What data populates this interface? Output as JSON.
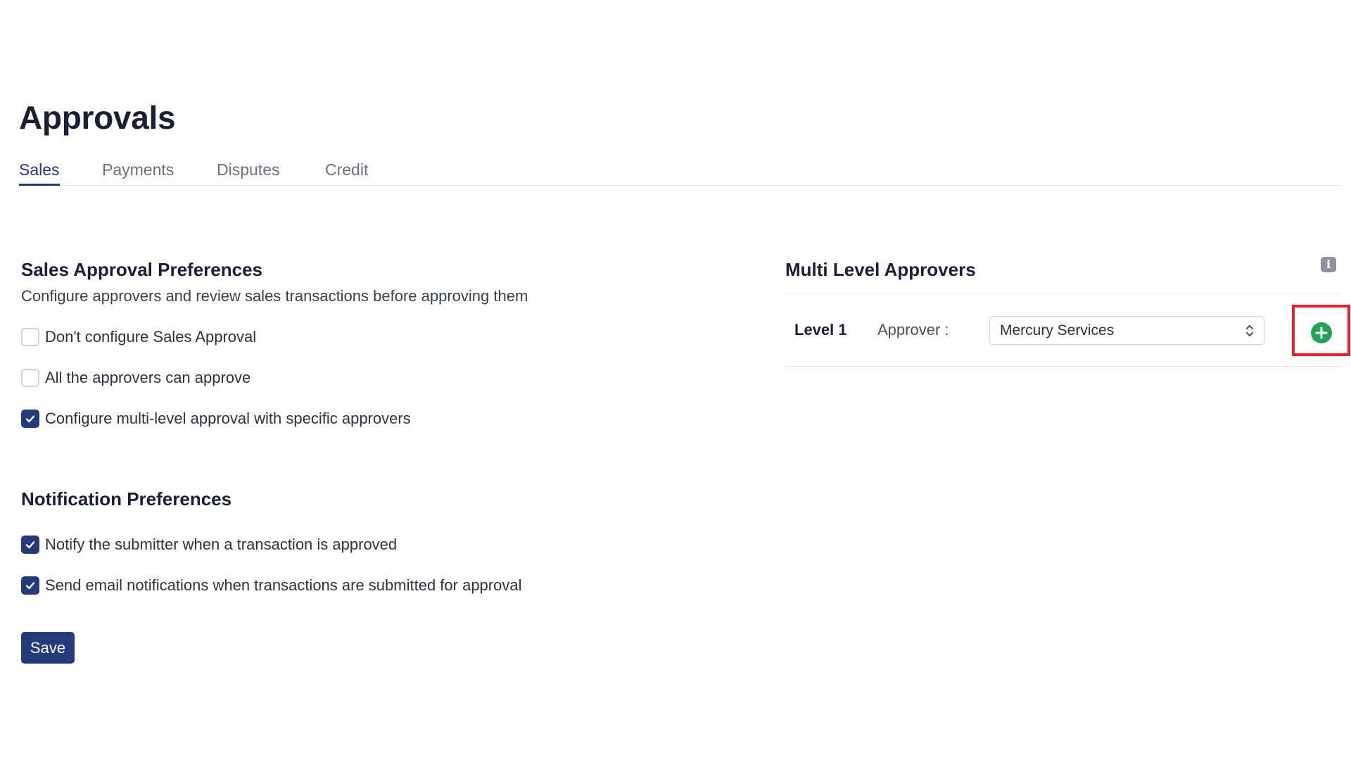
{
  "page": {
    "title": "Approvals"
  },
  "tabs": [
    {
      "label": "Sales",
      "active": true
    },
    {
      "label": "Payments",
      "active": false
    },
    {
      "label": "Disputes",
      "active": false
    },
    {
      "label": "Credit",
      "active": false
    }
  ],
  "sales_approval": {
    "title": "Sales Approval Preferences",
    "description": "Configure approvers and review sales transactions before approving them",
    "options": [
      {
        "label": "Don't configure Sales Approval",
        "checked": false
      },
      {
        "label": "All the approvers can approve",
        "checked": false
      },
      {
        "label": "Configure multi-level approval with specific approvers",
        "checked": true
      }
    ]
  },
  "notifications": {
    "title": "Notification Preferences",
    "options": [
      {
        "label": "Notify the submitter when a transaction is approved",
        "checked": true
      },
      {
        "label": "Send email notifications when transactions are submitted for approval",
        "checked": true
      }
    ]
  },
  "save_label": "Save",
  "multi_level": {
    "title": "Multi Level Approvers",
    "info_icon": "info-icon",
    "levels": [
      {
        "level_label": "Level 1",
        "approver_label": "Approver :",
        "approver_value": "Mercury Services"
      }
    ],
    "add_icon": "plus-circle-icon"
  },
  "colors": {
    "primary": "#253a7a",
    "add_button": "#23a455",
    "highlight": "#e8222b"
  }
}
